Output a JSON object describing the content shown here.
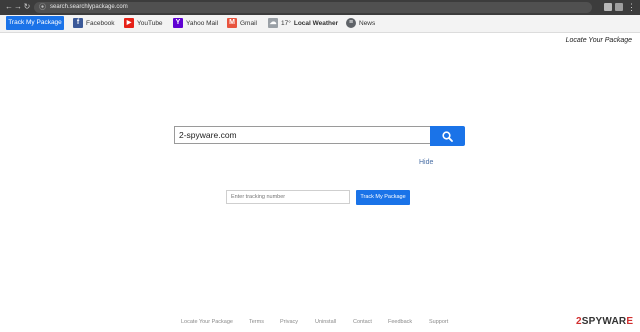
{
  "browser": {
    "url": "search.searchlypackage.com"
  },
  "toolbar": {
    "track_label": "Track My Package",
    "items": [
      {
        "label": "Facebook",
        "icon": "facebook-icon",
        "glyph": "f",
        "color": "#3b5998"
      },
      {
        "label": "YouTube",
        "icon": "youtube-icon",
        "glyph": "▶",
        "color": "#e62117"
      },
      {
        "label": "Yahoo Mail",
        "icon": "yahoo-icon",
        "glyph": "Y",
        "color": "#6001d2"
      },
      {
        "label": "Gmail",
        "icon": "gmail-icon",
        "glyph": "M",
        "color": "#e8543e"
      },
      {
        "label": "Local Weather",
        "temp": "17°",
        "icon": "weather-icon",
        "glyph": "☁",
        "color": "#9aa0a6"
      },
      {
        "label": "News",
        "icon": "news-icon",
        "glyph": "≡",
        "color": "#5f6368"
      }
    ]
  },
  "header": {
    "locate_label": "Locate Your Package"
  },
  "search": {
    "value": "2-spyware.com",
    "hide_label": "Hide"
  },
  "tracking": {
    "placeholder": "Enter tracking number",
    "button_label": "Track My Package"
  },
  "footer": {
    "links": [
      "Locate Your Package",
      "Terms",
      "Privacy",
      "Uninstall",
      "Contact",
      "Feedback",
      "Support"
    ]
  },
  "watermark": {
    "num": "2",
    "text": "SPYWAR",
    "plus": "E"
  },
  "colors": {
    "accent": "#1a73e8",
    "browser_chrome": "#3c3c3c",
    "toolbar_bg": "#f3f3f3"
  }
}
